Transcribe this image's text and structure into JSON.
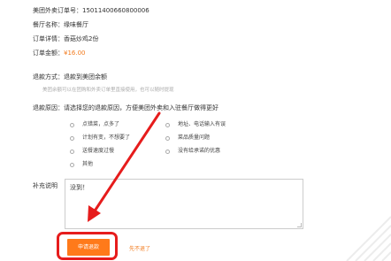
{
  "order": {
    "order_no_label": "美团外卖订单号：",
    "order_no_value": "15011400660800006",
    "restaurant_label": "餐厅名称：",
    "restaurant_value": "缘味餐厅",
    "detail_label": "订单详情：",
    "detail_value": "香菇炒鸡2份",
    "amount_label": "订单金额：",
    "amount_value": "¥16.00"
  },
  "refund": {
    "method_label": "退款方式：",
    "method_value": "退款到美团余额",
    "method_hint": "美团余额可以在团购和外卖订单里直接使用，也可以随时提现",
    "reason_label": "退款原因：",
    "reason_prompt": "请选择您的退款原因，方便美团外卖和入驻餐厅做得更好",
    "reasons": [
      "点错菜，点多了",
      "地址、电话输入有误",
      "计划有变，不想要了",
      "菜品质量问题",
      "送餐速度过慢",
      "没有给承诺的优惠",
      "其他"
    ]
  },
  "note": {
    "label": "补充说明",
    "value": "没到！"
  },
  "actions": {
    "submit_label": "申请退款",
    "cancel_label": "先不退了"
  },
  "colors": {
    "accent": "#ff7a1a",
    "highlight": "#e61c1c"
  }
}
